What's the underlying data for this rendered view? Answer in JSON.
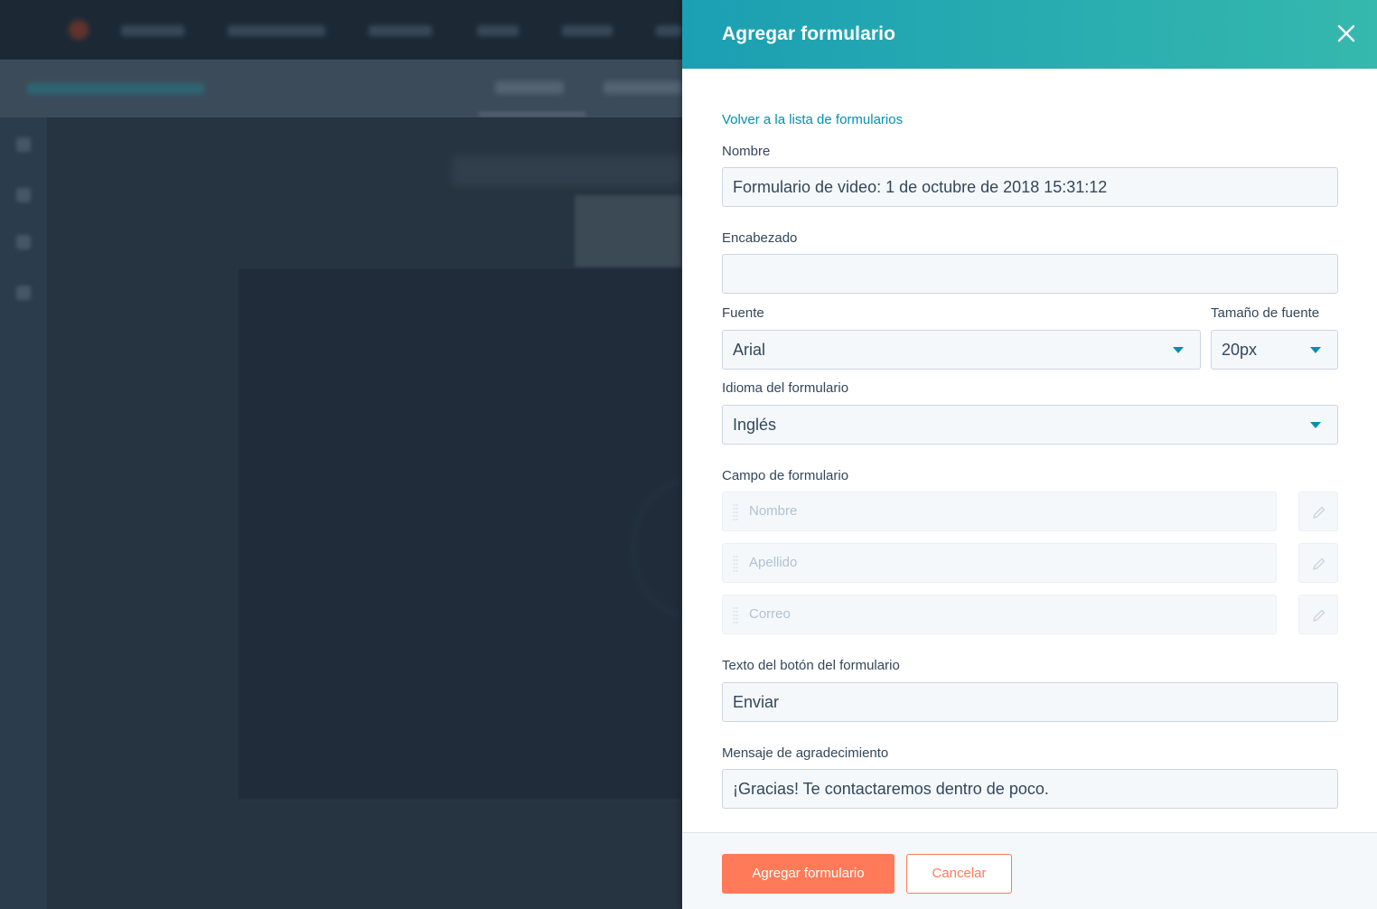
{
  "panel": {
    "title": "Agregar formulario",
    "back_link": "Volver a la lista de formularios"
  },
  "form": {
    "name": {
      "label": "Nombre",
      "value": "Formulario de video: 1 de octubre de 2018 15:31:12"
    },
    "heading": {
      "label": "Encabezado",
      "value": ""
    },
    "font": {
      "label": "Fuente",
      "value": "Arial"
    },
    "font_size": {
      "label": "Tamaño de fuente",
      "value": "20px"
    },
    "language": {
      "label": "Idioma del formulario",
      "value": "Inglés"
    },
    "fields": {
      "label": "Campo de formulario",
      "items": [
        {
          "label": "Nombre"
        },
        {
          "label": "Apellido"
        },
        {
          "label": "Correo"
        }
      ]
    },
    "button_text": {
      "label": "Texto del botón del formulario",
      "value": "Enviar"
    },
    "thanks_message": {
      "label": "Mensaje de agradecimiento",
      "value": "¡Gracias! Te contactaremos dentro de poco."
    }
  },
  "footer": {
    "submit_label": "Agregar formulario",
    "cancel_label": "Cancelar"
  },
  "colors": {
    "header_start": "#1b9fb3",
    "header_end": "#35b8ad",
    "accent": "#ff7a59",
    "link": "#0091ae"
  },
  "icons": {
    "close": "close-icon",
    "caret": "caret-down-icon",
    "edit": "pencil-icon",
    "drag": "drag-handle-icon"
  }
}
